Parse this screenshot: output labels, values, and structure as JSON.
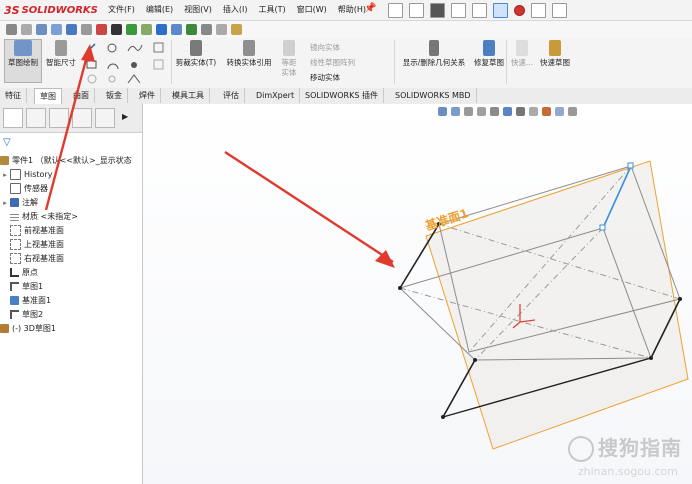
{
  "app": {
    "brand_ds": "3S",
    "brand_name": "SOLIDWORKS"
  },
  "menu": [
    "文件(F)",
    "编辑(E)",
    "视图(V)",
    "插入(I)",
    "工具(T)",
    "窗口(W)",
    "帮助(H)"
  ],
  "ribbon": {
    "sketch": "草图绘制",
    "smart_dim": "智能尺寸",
    "trim": "剪裁实体(T)",
    "convert": "转换实体引用",
    "offset_surface": "等距实体",
    "equidistant": "等距实体",
    "mirror": "镜向实体",
    "linear_pattern": "线性草图阵列",
    "move": "移动实体",
    "relations": "显示/删除几何关系",
    "repair": "修复草图",
    "quick_snap": "快速...",
    "rapid_sketch": "快速草图"
  },
  "tabs": [
    "特征",
    "草图",
    "曲面",
    "钣金",
    "焊件",
    "模具工具",
    "评估",
    "DimXpert",
    "SOLIDWORKS 插件",
    "SOLIDWORKS MBD"
  ],
  "active_tab": "草图",
  "tree": {
    "root": "零件1 （默认<<默认>_显示状态",
    "items": [
      "History",
      "传感器",
      "注解",
      "材质 <未指定>",
      "前视基准面",
      "上视基准面",
      "右视基准面",
      "原点",
      "草图1",
      "基准面1",
      "草图2",
      "(-) 3D草图1"
    ]
  },
  "viewport": {
    "plane_label": "基准面1"
  },
  "watermark": {
    "text": "搜狗指南",
    "sub": "zhinan.sogou.com"
  },
  "colors": {
    "brand_red": "#d2232a",
    "plane_orange": "#f0a030",
    "arrow_red": "#e03a2e",
    "highlight_blue": "#3a8fe0"
  }
}
